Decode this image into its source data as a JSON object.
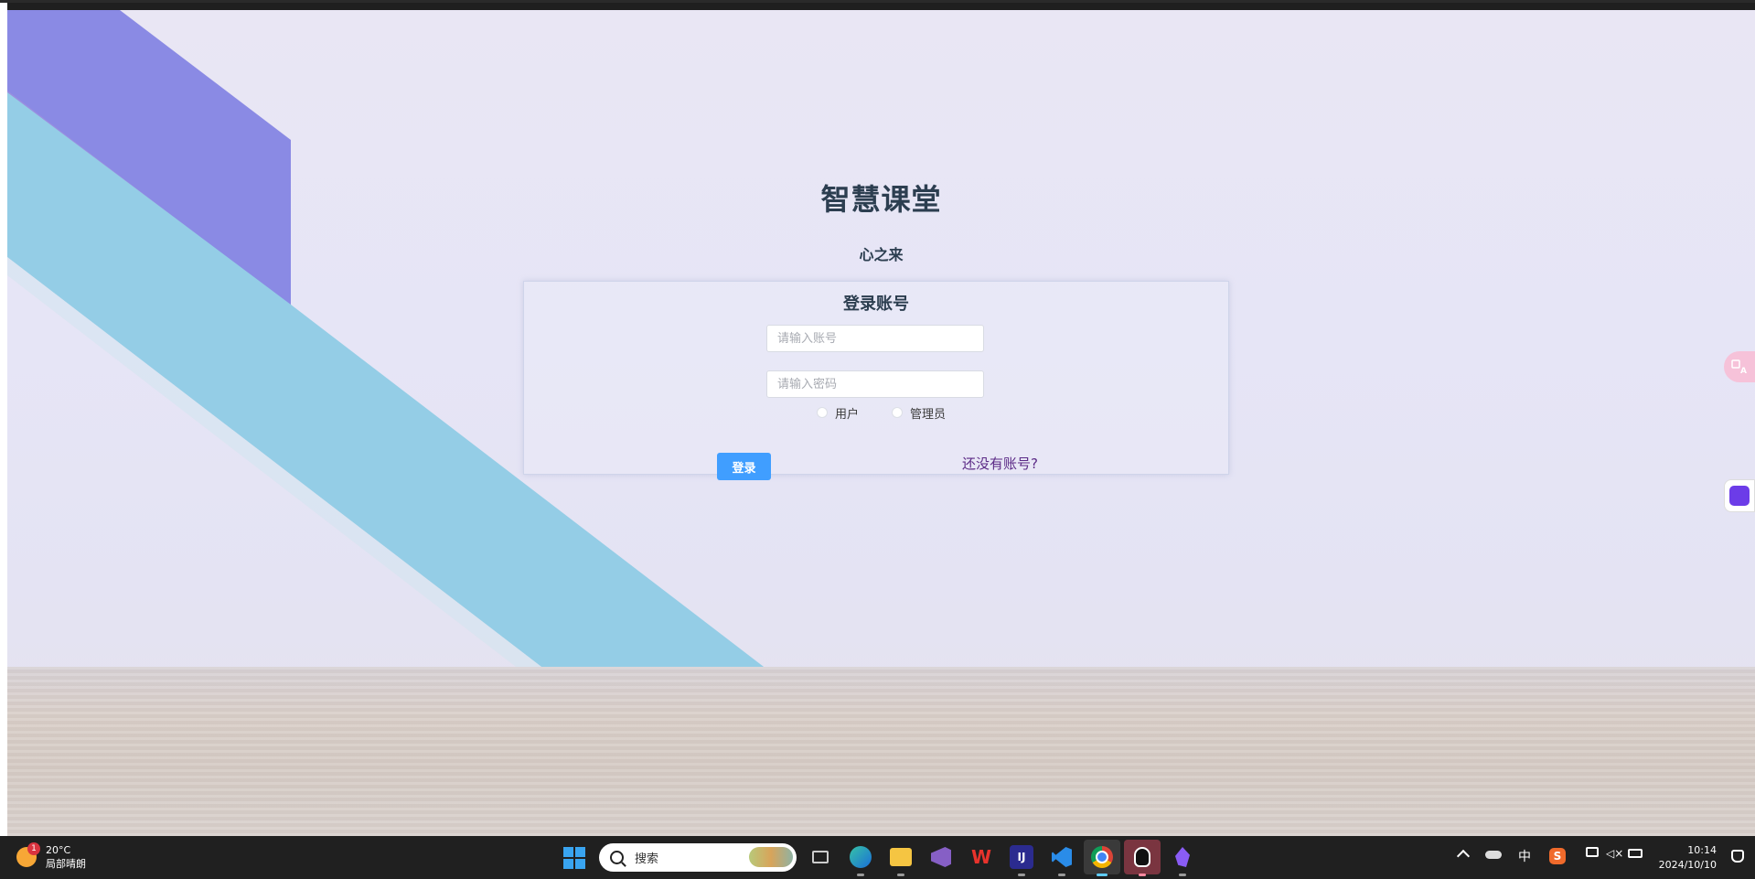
{
  "page": {
    "title": "智慧课堂",
    "subtitle": "心之来"
  },
  "login": {
    "heading": "登录账号",
    "account_placeholder": "请输入账号",
    "password_placeholder": "请输入密码",
    "roles": [
      "用户",
      "管理员"
    ],
    "login_label": "登录",
    "register_link": "还没有账号?"
  },
  "colors": {
    "primary_button": "#409eff",
    "link": "#5b2a86",
    "title": "#2c3e50"
  },
  "side_widgets": [
    "translate-icon",
    "chat-widget-icon"
  ],
  "taskbar": {
    "weather_temp": "20°C",
    "weather_desc": "局部晴朗",
    "weather_badge": "1",
    "search_label": "搜索",
    "apps": [
      "task-view-icon",
      "edge-icon",
      "file-explorer-icon",
      "visual-studio-icon",
      "wps-icon",
      "intellij-icon",
      "vscode-icon",
      "chrome-icon",
      "qq-icon",
      "obsidian-icon"
    ],
    "tray": {
      "ime": "中",
      "time": "10:14",
      "date": "2024/10/10"
    }
  }
}
